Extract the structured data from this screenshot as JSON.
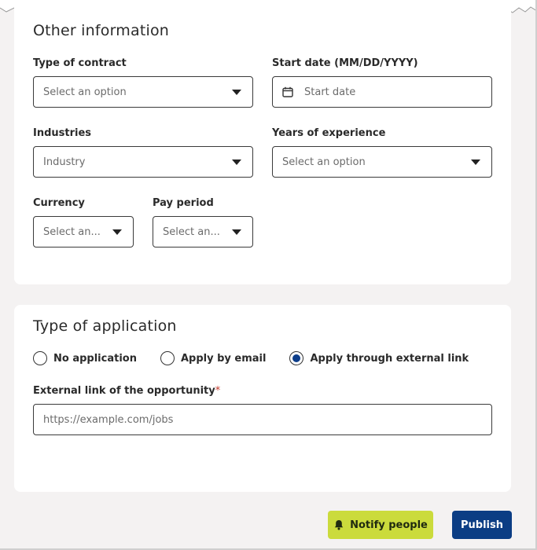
{
  "other_info": {
    "title": "Other information",
    "contract": {
      "label": "Type of contract",
      "placeholder": "Select an option"
    },
    "start_date": {
      "label": "Start date (MM/DD/YYYY)",
      "placeholder": "Start date"
    },
    "industries": {
      "label": "Industries",
      "placeholder": "Industry"
    },
    "experience": {
      "label": "Years of experience",
      "placeholder": "Select an option"
    },
    "currency": {
      "label": "Currency",
      "placeholder": "Select an..."
    },
    "pay_period": {
      "label": "Pay period",
      "placeholder": "Select an..."
    }
  },
  "application": {
    "title": "Type of application",
    "options": [
      {
        "label": "No application",
        "selected": false
      },
      {
        "label": "Apply by email",
        "selected": false
      },
      {
        "label": "Apply through external link",
        "selected": true
      }
    ],
    "external_link": {
      "label": "External link of the opportunity",
      "required_mark": "*",
      "placeholder": "https://example.com/jobs"
    }
  },
  "actions": {
    "notify_label": "Notify people",
    "publish_label": "Publish"
  },
  "colors": {
    "accent": "#0b3d84",
    "notify": "#cbdb3c"
  }
}
